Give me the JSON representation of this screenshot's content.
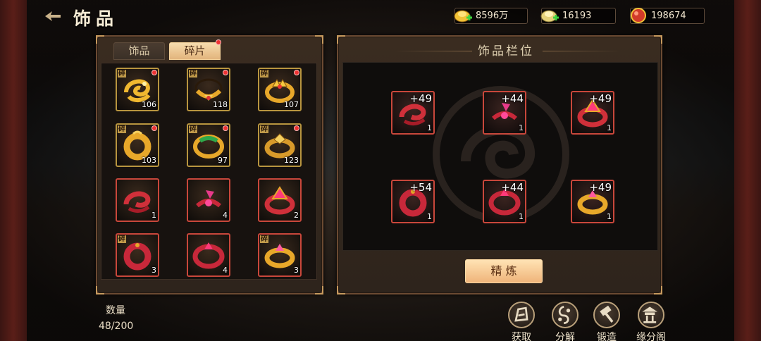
{
  "header": {
    "title": "饰品"
  },
  "resources": [
    {
      "icon": "gold-ingot-icon",
      "value": "8596万"
    },
    {
      "icon": "silver-ingot-icon",
      "value": "16193"
    },
    {
      "icon": "red-gem-icon",
      "value": "198674"
    }
  ],
  "tabs": [
    {
      "label": "饰品"
    },
    {
      "label": "碎片"
    }
  ],
  "fragment_badge": "碎",
  "items": [
    {
      "count": "106",
      "icon": "gold-dragon-ring-icon"
    },
    {
      "count": "118",
      "icon": "gold-circlet-icon"
    },
    {
      "count": "107",
      "icon": "gold-crown-ring-icon"
    },
    {
      "count": "103",
      "icon": "gold-disc-ring-icon"
    },
    {
      "count": "97",
      "icon": "jade-bracelet-icon"
    },
    {
      "count": "123",
      "icon": "gold-band-ring-icon"
    },
    {
      "count": "1",
      "icon": "red-dragon-ring-icon"
    },
    {
      "count": "4",
      "icon": "red-jewel-cluster-icon"
    },
    {
      "count": "2",
      "icon": "red-crown-ring-icon"
    },
    {
      "count": "3",
      "icon": "red-disc-ring-icon"
    },
    {
      "count": "4",
      "icon": "red-band-ring-icon"
    },
    {
      "count": "3",
      "icon": "gold-pink-ring-icon"
    }
  ],
  "quantity": {
    "label": "数量",
    "value": "48/200"
  },
  "slots_panel": {
    "title": "饰品栏位",
    "slots": [
      {
        "bonus": "+49",
        "count": "1",
        "icon": "red-dragon-ring-icon"
      },
      {
        "bonus": "+44",
        "count": "1",
        "icon": "red-jewel-cluster-icon"
      },
      {
        "bonus": "+49",
        "count": "1",
        "icon": "red-crown-ring-icon"
      },
      {
        "bonus": "+54",
        "count": "1",
        "icon": "red-disc-ring-icon"
      },
      {
        "bonus": "+44",
        "count": "1",
        "icon": "red-band-ring-icon"
      },
      {
        "bonus": "+49",
        "count": "1",
        "icon": "gold-pink-ring-icon"
      }
    ],
    "refine_button": "精 炼"
  },
  "bottom_buttons": [
    {
      "label": "获取",
      "icon": "obtain-icon"
    },
    {
      "label": "分解",
      "icon": "decompose-icon"
    },
    {
      "label": "锻造",
      "icon": "forge-hammer-icon"
    },
    {
      "label": "缘分阁",
      "icon": "pavilion-icon"
    }
  ],
  "colors": {
    "accent": "#e2b47c",
    "red_border": "#c9473b",
    "gold_border": "#b8953f"
  }
}
